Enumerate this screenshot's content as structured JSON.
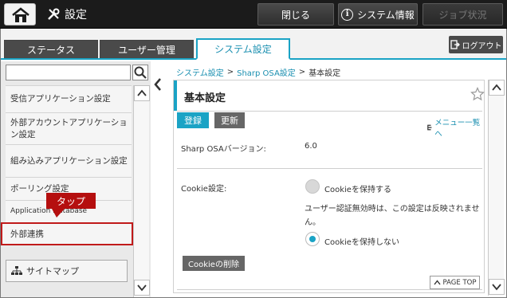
{
  "topbar": {
    "title": "設定",
    "close_label": "閉じる",
    "system_info_label": "システム情報",
    "job_status_label": "ジョブ状況"
  },
  "tabs": [
    {
      "label": "ステータス",
      "active": false
    },
    {
      "label": "ユーザー管理",
      "active": false
    },
    {
      "label": "システム設定",
      "active": true
    }
  ],
  "logout_label": "ログアウト",
  "sidebar": {
    "search_placeholder": "",
    "items": [
      {
        "label": "受信アプリケーション設定"
      },
      {
        "label": "外部アカウントアプリケーション設定"
      },
      {
        "label": "組み込みアプリケーション設定"
      },
      {
        "label": "ポーリング設定"
      },
      {
        "label": "Application Database"
      },
      {
        "label": "外部連携"
      }
    ],
    "highlighted_item": "外部連携",
    "callout": "タップ",
    "sitemap_label": "サイトマップ"
  },
  "breadcrumb": {
    "items": [
      "システム設定",
      "Sharp OSA設定",
      "基本設定"
    ],
    "separator": ">"
  },
  "panel": {
    "title": "基本設定",
    "register_label": "登録",
    "update_label": "更新",
    "menu_link_label": "メニュー一覧へ",
    "version_label": "Sharp OSAバージョン:",
    "version_value": "6.0",
    "cookie_label": "Cookie設定:",
    "cookie_keep_label": "Cookieを保持する",
    "cookie_note": "ユーザー認証無効時は、この設定は反映されません。",
    "cookie_nokeep_label": "Cookieを保持しない",
    "cookie_selected": "Cookieを保持しない",
    "cookie_delete_label": "Cookieの削除",
    "page_top_label": "PAGE TOP"
  },
  "colors": {
    "accent": "#1aa3c5",
    "highlight": "#c01a1a",
    "topbar": "#1b1b1b"
  }
}
